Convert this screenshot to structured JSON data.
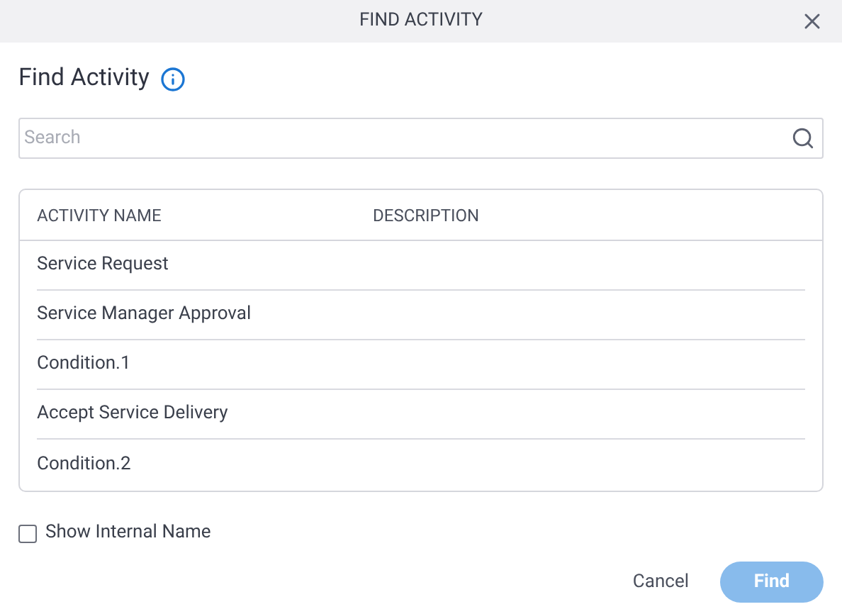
{
  "window": {
    "title": "FIND ACTIVITY"
  },
  "heading": "Find Activity",
  "search": {
    "placeholder": "Search"
  },
  "table": {
    "columns": [
      "ACTIVITY NAME",
      "DESCRIPTION"
    ],
    "rows": [
      {
        "name": "Service Request"
      },
      {
        "name": "Service Manager Approval"
      },
      {
        "name": "Condition.1"
      },
      {
        "name": "Accept Service Delivery"
      },
      {
        "name": "Condition.2"
      }
    ]
  },
  "show_internal_name": {
    "label": "Show Internal Name",
    "checked": false
  },
  "buttons": [
    {
      "label": "Cancel",
      "kind": "text",
      "disabled": false
    },
    {
      "label": "Find",
      "kind": "primary",
      "disabled": true
    }
  ]
}
